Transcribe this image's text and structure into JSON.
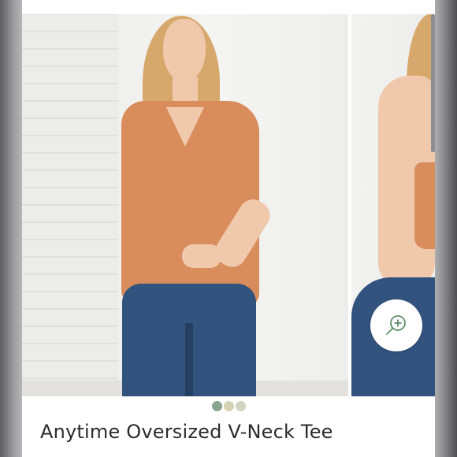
{
  "product": {
    "title": "Anytime Oversized V-Neck Tee",
    "main_image_alt": "Model wearing orange oversized v-neck tee with blue jeans",
    "second_image_alt": "Close-up of tee sleeve"
  },
  "gallery": {
    "current_index": 1,
    "total_images": 3
  },
  "swatches": [
    {
      "color": "#8aa58d"
    },
    {
      "color": "#d5d3b4"
    },
    {
      "color": "#cfd5c0"
    }
  ],
  "zoom": {
    "icon": "zoom-in-icon"
  },
  "colors": {
    "tee": "#d98c5c",
    "jeans": "#32537d",
    "background": "#ffffff"
  }
}
